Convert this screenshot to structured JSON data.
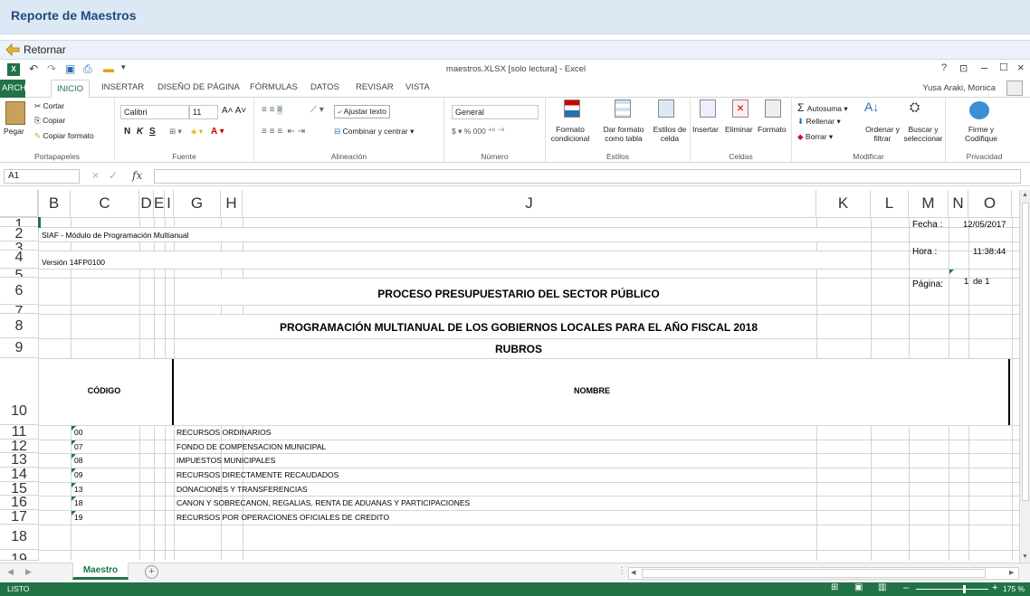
{
  "window": {
    "title": "Reporte de Maestros",
    "back_label": "Retornar"
  },
  "excel": {
    "title": "maestros.XLSX  [solo lectura] - Excel",
    "user": "Yusa Araki, Monica",
    "help": "?"
  },
  "ribbon_tabs": [
    "ARCHIVO",
    "INICIO",
    "INSERTAR",
    "DISEÑO DE PÁGINA",
    "FÓRMULAS",
    "DATOS",
    "REVISAR",
    "VISTA"
  ],
  "ribbon": {
    "clipboard": {
      "paste": "Pegar",
      "cut": "Cortar",
      "copy": "Copiar",
      "format": "Copiar formato",
      "label": "Portapapeles"
    },
    "font": {
      "name": "Calibri",
      "size": "11",
      "bold": "N",
      "italic": "K",
      "underline": "S",
      "label": "Fuente"
    },
    "align": {
      "wrap": "Ajustar texto",
      "merge": "Combinar y centrar",
      "label": "Alineación"
    },
    "number": {
      "format": "General",
      "label": "Número"
    },
    "styles": {
      "cond": "Formato condicional",
      "table": "Dar formato como tabla",
      "cell": "Estilos de celda",
      "label": "Estilos"
    },
    "cells": {
      "insert": "Insertar",
      "delete": "Eliminar",
      "format": "Formato",
      "label": "Celdas"
    },
    "modify": {
      "autosum": "Autosuma",
      "fill": "Rellenar",
      "clear": "Borrar",
      "sort": "Ordenar y filtrar",
      "find": "Buscar y seleccionar",
      "label": "Modificar"
    },
    "privacy": {
      "sign": "Firme y Codifique",
      "label": "Privacidad"
    }
  },
  "namebox": "A1",
  "columns": [
    "B",
    "C",
    "D",
    "E",
    "I",
    "G",
    "H",
    "J",
    "K",
    "L",
    "M",
    "N",
    "O"
  ],
  "rows": [
    "1",
    "2",
    "3",
    "4",
    "5",
    "6",
    "7",
    "8",
    "9",
    "10",
    "11",
    "12",
    "13",
    "14",
    "15",
    "16",
    "17",
    "18",
    "19"
  ],
  "sheet": {
    "system": "SIAF - Módulo de Programación Multianual",
    "version": "Versión 14FP0100",
    "fecha_label": "Fecha :",
    "fecha": "12/05/2017",
    "hora_label": "Hora  :",
    "hora": "11:38:44",
    "pagina_label": "Página:",
    "pagina": "1",
    "de": "de 1",
    "title1": "PROCESO PRESUPUESTARIO DEL SECTOR PÚBLICO",
    "title2": "PROGRAMACIÓN MULTIANUAL DE LOS GOBIERNOS LOCALES PARA EL AÑO FISCAL 2018",
    "title3": "RUBROS",
    "h_codigo": "CÓDIGO",
    "h_nombre": "NOMBRE",
    "items": [
      {
        "code": "00",
        "name": "RECURSOS ORDINARIOS"
      },
      {
        "code": "07",
        "name": "FONDO DE COMPENSACION MUNICIPAL"
      },
      {
        "code": "08",
        "name": "IMPUESTOS MUNICIPALES"
      },
      {
        "code": "09",
        "name": "RECURSOS DIRECTAMENTE RECAUDADOS"
      },
      {
        "code": "13",
        "name": "DONACIONES Y TRANSFERENCIAS"
      },
      {
        "code": "18",
        "name": "CANON Y SOBRECANON, REGALIAS, RENTA DE ADUANAS Y PARTICIPACIONES"
      },
      {
        "code": "19",
        "name": "RECURSOS POR OPERACIONES OFICIALES DE CREDITO"
      }
    ]
  },
  "sheet_tab": "Maestro",
  "status": {
    "mode": "LISTO",
    "zoom": "175 %"
  }
}
